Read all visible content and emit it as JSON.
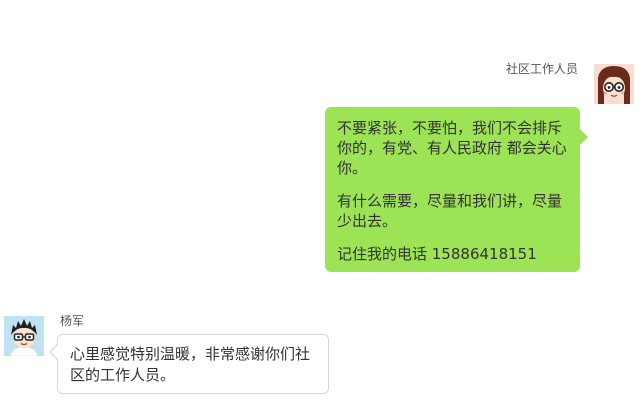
{
  "messages": [
    {
      "direction": "outgoing",
      "sender": "社区工作人员",
      "avatar_icon": "female-avatar-with-glasses-icon",
      "bubble_color": "#9de356",
      "paragraphs": [
        "不要紧张，不要怕，我们不会排斥你的，有党、有人民政府 都会关心你。",
        "有什么需要，尽量和我们讲，尽量少出去。",
        "记住我的电话 15886418151"
      ]
    },
    {
      "direction": "incoming",
      "sender": "杨军",
      "avatar_icon": "male-avatar-with-glasses-icon",
      "bubble_color": "#ffffff",
      "paragraphs": [
        "心里感觉特别温暖，非常感谢你们社区的工作人员。"
      ]
    }
  ]
}
